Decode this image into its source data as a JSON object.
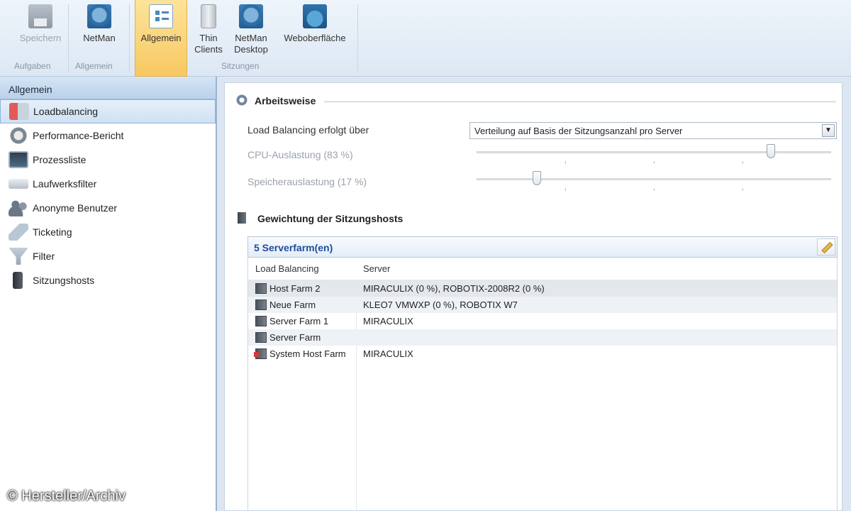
{
  "ribbon": {
    "buttons": [
      {
        "label": "Speichern",
        "icon": "save-icon",
        "state": "disabled"
      },
      {
        "label": "NetMan",
        "icon": "netman-icon",
        "state": "normal"
      },
      {
        "label": "Allgemein",
        "icon": "general-settings-icon",
        "state": "active"
      },
      {
        "label": "Thin\nClients",
        "icon": "thin-client-icon",
        "state": "normal"
      },
      {
        "label": "NetMan\nDesktop",
        "icon": "netman-desktop-icon",
        "state": "normal"
      },
      {
        "label": "Weboberfläche",
        "icon": "web-interface-icon",
        "state": "normal"
      }
    ],
    "groups": [
      "Aufgaben",
      "Allgemein",
      "Sitzungen"
    ]
  },
  "sidebar": {
    "header": "Allgemein",
    "items": [
      {
        "label": "Loadbalancing",
        "icon": "loadbalancing-icon",
        "selected": true
      },
      {
        "label": "Performance-Bericht",
        "icon": "performance-report-icon",
        "selected": false
      },
      {
        "label": "Prozessliste",
        "icon": "process-list-icon",
        "selected": false
      },
      {
        "label": "Laufwerksfilter",
        "icon": "drive-filter-icon",
        "selected": false
      },
      {
        "label": "Anonyme Benutzer",
        "icon": "anonymous-users-icon",
        "selected": false
      },
      {
        "label": "Ticketing",
        "icon": "ticketing-icon",
        "selected": false
      },
      {
        "label": "Filter",
        "icon": "filter-icon",
        "selected": false
      },
      {
        "label": "Sitzungshosts",
        "icon": "session-hosts-icon",
        "selected": false
      }
    ]
  },
  "watermark": "© Hersteller/Archiv",
  "main": {
    "arbeitsweise": {
      "title": "Arbeitsweise",
      "lb_label": "Load Balancing erfolgt über",
      "lb_value": "Verteilung auf Basis der Sitzungsanzahl pro Server",
      "cpu_label": "CPU-Auslastung (83 %)",
      "cpu_value": 83,
      "mem_label": "Speicherauslastung (17 %)",
      "mem_value": 17
    },
    "gewichtung": {
      "title": "Gewichtung der Sitzungshosts",
      "farm_header": "5 Serverfarm(en)",
      "columns": [
        "Load Balancing",
        "Server"
      ],
      "rows": [
        {
          "name": "Host Farm 2",
          "servers": "MIRACULIX (0 %), ROBOTIX-2008R2 (0 %)",
          "icon": "farm-icon"
        },
        {
          "name": "Neue Farm",
          "servers": "KLEO7 VMWXP (0 %), ROBOTIX W7",
          "icon": "farm-icon"
        },
        {
          "name": "Server Farm 1",
          "servers": "MIRACULIX",
          "icon": "farm-icon"
        },
        {
          "name": "Server Farm",
          "servers": "",
          "icon": "farm-icon"
        },
        {
          "name": "System Host Farm",
          "servers": "MIRACULIX",
          "icon": "system-farm-icon"
        }
      ]
    }
  }
}
